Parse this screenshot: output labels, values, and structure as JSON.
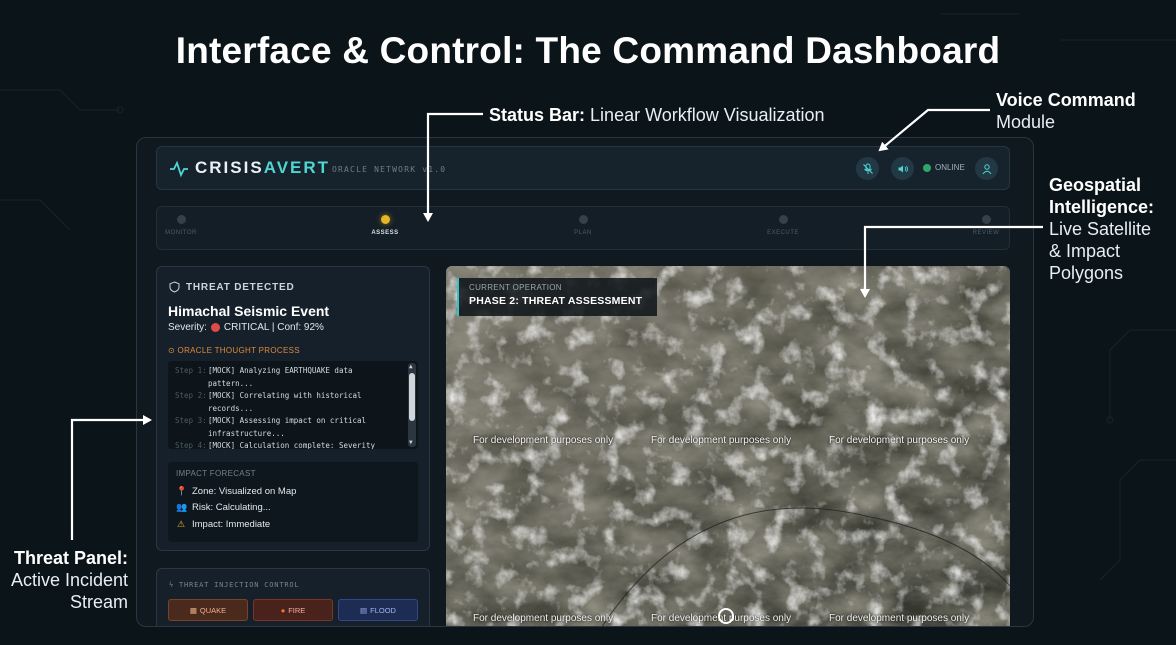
{
  "slide": {
    "title": "Interface & Control: The Command Dashboard"
  },
  "callouts": {
    "status_bar": {
      "bold": "Status Bar:",
      "text": "Linear Workflow Visualization"
    },
    "voice": {
      "bold": "Voice Command",
      "text": "Module"
    },
    "geo": {
      "bold1": "Geospatial",
      "bold2": "Intelligence:",
      "line3": "Live Satellite",
      "line4": "& Impact",
      "line5": "Polygons"
    },
    "threat": {
      "bold": "Threat Panel:",
      "line2": "Active Incident",
      "line3": "Stream"
    }
  },
  "header": {
    "brand_a": "CRISIS",
    "brand_b": "AVERT",
    "network": "ORACLE NETWORK v1.0",
    "status": "ONLINE",
    "icons": [
      "activity-icon",
      "mic-off-icon",
      "speaker-icon",
      "user-icon"
    ]
  },
  "workflow": {
    "steps": [
      "MONITOR",
      "ASSESS",
      "PLAN",
      "EXECUTE",
      "REVIEW"
    ],
    "active_index": 1
  },
  "threat": {
    "heading": "THREAT DETECTED",
    "title": "Himachal Seismic Event",
    "severity_label": "Severity:",
    "severity": "CRITICAL | Conf: 92%",
    "oracle_label": "ORACLE THOUGHT PROCESS",
    "log": [
      {
        "step": "Step 1:",
        "line1": "[MOCK] Analyzing EARTHQUAKE data",
        "line2": "pattern..."
      },
      {
        "step": "Step 2:",
        "line1": "[MOCK] Correlating with historical",
        "line2": "records..."
      },
      {
        "step": "Step 3:",
        "line1": "[MOCK] Assessing impact on critical",
        "line2": "infrastructure..."
      },
      {
        "step": "Step 4:",
        "line1": "[MOCK] Calculation complete: Severity",
        "line2": ""
      }
    ],
    "impact_heading": "IMPACT FORECAST",
    "impact": [
      {
        "icon": "pin-icon",
        "text": "Zone: Visualized on Map"
      },
      {
        "icon": "people-icon",
        "text": "Risk: Calculating..."
      },
      {
        "icon": "warning-icon",
        "text": "Impact: Immediate"
      }
    ]
  },
  "injection": {
    "heading": "THREAT INJECTION CONTROL",
    "buttons": [
      "QUAKE",
      "FIRE",
      "FLOOD"
    ]
  },
  "map": {
    "op_label": "CURRENT OPERATION",
    "op_value": "PHASE 2: THREAT ASSESSMENT",
    "watermark": "For development purposes only"
  },
  "colors": {
    "accent": "#4fd6d2",
    "active_step": "#e2b625",
    "critical": "#e04a4a",
    "oracle": "#e0883b",
    "online": "#2fa56a"
  }
}
